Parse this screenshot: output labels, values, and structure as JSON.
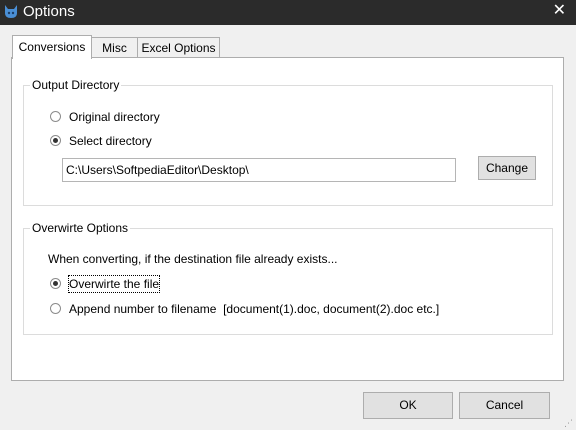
{
  "window": {
    "title": "Options",
    "close_glyph": "✕"
  },
  "tabs": [
    {
      "label": "Conversions",
      "active": true
    },
    {
      "label": "Misc",
      "active": false
    },
    {
      "label": "Excel Options",
      "active": false
    }
  ],
  "output_directory": {
    "legend": "Output Directory",
    "options": [
      {
        "label": "Original directory",
        "checked": false
      },
      {
        "label": "Select directory",
        "checked": true
      }
    ],
    "path_value": "C:\\Users\\SoftpediaEditor\\Desktop\\",
    "change_button": "Change"
  },
  "overwrite_options": {
    "legend": "Overwirte Options",
    "description": "When converting, if the destination file already exists...",
    "options": [
      {
        "label": "Overwirte the file",
        "checked": true
      },
      {
        "label": "Append number to filename  [document(1).doc, document(2).doc etc.]",
        "checked": false
      }
    ]
  },
  "footer": {
    "ok_label": "OK",
    "cancel_label": "Cancel"
  },
  "colors": {
    "titlebar": "#2b2b2b",
    "app_icon": "#4a8fd6",
    "window_bg": "#f0f0f0"
  },
  "icons": {
    "app": "cat-logo-icon",
    "close": "close-icon"
  }
}
